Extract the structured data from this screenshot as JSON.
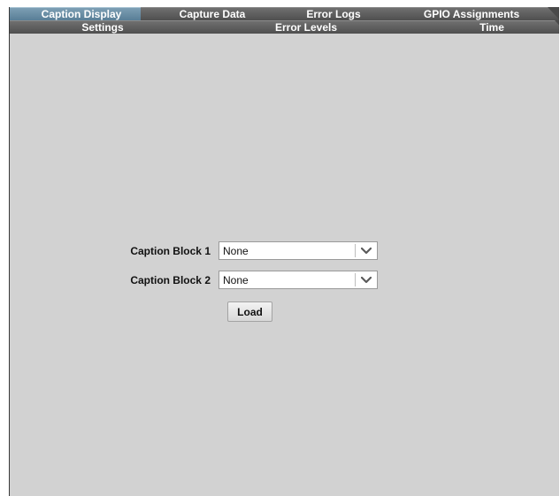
{
  "tabs": {
    "row1": [
      {
        "label": "Caption Display",
        "active": true
      },
      {
        "label": "Capture Data",
        "active": false
      },
      {
        "label": "Error Logs",
        "active": false
      },
      {
        "label": "GPIO Assignments",
        "active": false
      }
    ],
    "row2": [
      {
        "label": "Settings",
        "active": false
      },
      {
        "label": "Error Levels",
        "active": false
      },
      {
        "label": "Time",
        "active": false
      }
    ]
  },
  "form": {
    "caption_block_1": {
      "label": "Caption Block 1",
      "value": "None",
      "icon": "chevron-down-icon"
    },
    "caption_block_2": {
      "label": "Caption Block 2",
      "value": "None",
      "icon": "chevron-down-icon"
    },
    "load_label": "Load"
  },
  "colors": {
    "panel_background": "#d2d2d2",
    "active_tab": "#6e93aa",
    "inactive_tab": "#5d5d5d"
  }
}
